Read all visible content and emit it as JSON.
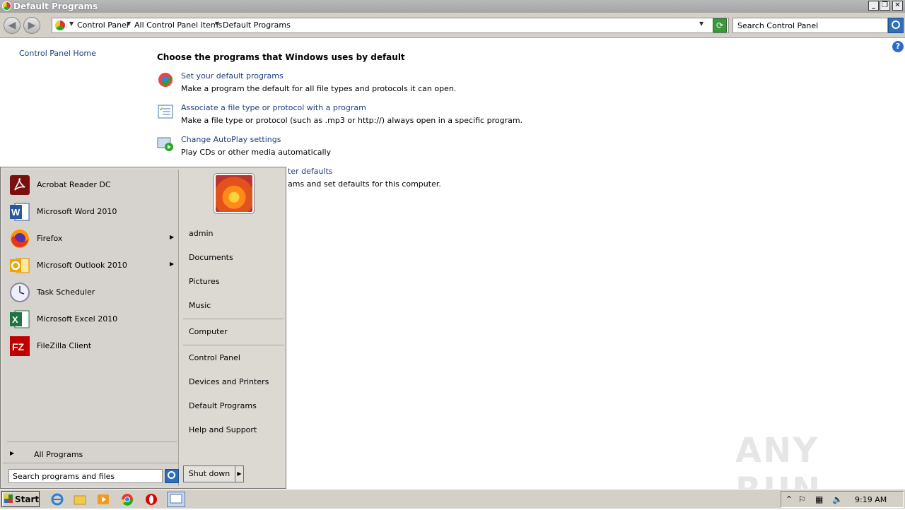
{
  "window": {
    "title": "Default Programs",
    "controls": [
      "_",
      "❐",
      "✕"
    ]
  },
  "address": {
    "crumbs": [
      "Control Panel",
      "All Control Panel Items",
      "Default Programs"
    ],
    "search_placeholder": "Search Control Panel"
  },
  "sidebar": {
    "home_link": "Control Panel Home"
  },
  "main": {
    "heading": "Choose the programs that Windows uses by default",
    "tasks": [
      {
        "link": "Set your default programs",
        "desc": "Make a program the default for all file types and protocols it can open."
      },
      {
        "link": "Associate a file type or protocol with a program",
        "desc": "Make a file type or protocol (such as .mp3 or http://) always open in a specific program."
      },
      {
        "link": "Change AutoPlay settings",
        "desc": "Play CDs or other media automatically"
      },
      {
        "link": "ter defaults",
        "desc": "ams and set defaults for this computer."
      }
    ]
  },
  "start_menu": {
    "programs": [
      {
        "label": "Acrobat Reader DC",
        "icon": "acrobat-icon",
        "arrow": false
      },
      {
        "label": "Microsoft Word 2010",
        "icon": "word-icon",
        "arrow": false
      },
      {
        "label": "Firefox",
        "icon": "firefox-icon",
        "arrow": true
      },
      {
        "label": "Microsoft Outlook 2010",
        "icon": "outlook-icon",
        "arrow": true
      },
      {
        "label": "Task Scheduler",
        "icon": "clock-icon",
        "arrow": false
      },
      {
        "label": "Microsoft Excel 2010",
        "icon": "excel-icon",
        "arrow": false
      },
      {
        "label": "FileZilla Client",
        "icon": "filezilla-icon",
        "arrow": false
      }
    ],
    "all_programs": "All Programs",
    "search_placeholder": "Search programs and files",
    "right_items": [
      "admin",
      "Documents",
      "Pictures",
      "Music",
      "Computer",
      "Control Panel",
      "Devices and Printers",
      "Default Programs",
      "Help and Support"
    ],
    "shutdown": "Shut down"
  },
  "taskbar": {
    "start_label": "Start",
    "clock": "9:19 AM"
  },
  "watermark": "ANY RUN"
}
